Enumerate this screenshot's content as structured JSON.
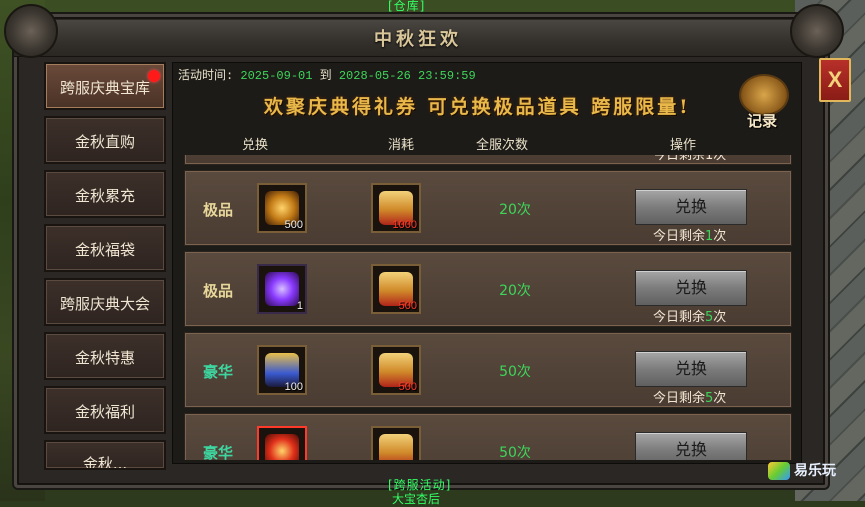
{
  "window": {
    "title": "中秋狂欢",
    "close_label": "X"
  },
  "scene": {
    "top_label": "[仓库]",
    "bottom_label_1": "[跨服活动]",
    "bottom_label_2": "大宝杏后"
  },
  "sidebar": {
    "items": [
      {
        "label": "跨服庆典宝库",
        "active": true,
        "notify": true
      },
      {
        "label": "金秋直购"
      },
      {
        "label": "金秋累充"
      },
      {
        "label": "金秋福袋"
      },
      {
        "label": "跨服庆典大会"
      },
      {
        "label": "金秋特惠"
      },
      {
        "label": "金秋福利"
      },
      {
        "label": "金秋..."
      }
    ]
  },
  "activity": {
    "time_label": "活动时间:",
    "start": "2025-09-01",
    "to": "到",
    "end": "2028-05-26 23:59:59",
    "banner": "欢聚庆典得礼券 可兑换极品道具 跨服限量!",
    "record_label": "记录"
  },
  "table": {
    "headers": {
      "exchange": "兑换",
      "cost": "消耗",
      "server_count": "全服次数",
      "action": "操作"
    },
    "partial_top_text": "今日剩余1次",
    "rows": [
      {
        "grade": "极品",
        "grade_color": "#e8d79a",
        "item_icon": "golden-ring-icon",
        "item_qty": "500",
        "cost_icon": "scroll-icon",
        "cost_qty": "1000",
        "count": "20次",
        "button": "兑换",
        "remain_prefix": "今日剩余",
        "remain_num": "1",
        "remain_suffix": "次"
      },
      {
        "grade": "极品",
        "grade_color": "#e8d79a",
        "item_icon": "purple-key-icon",
        "item_qty": "1",
        "cost_icon": "scroll-icon",
        "cost_qty": "500",
        "count": "20次",
        "button": "兑换",
        "remain_prefix": "今日剩余",
        "remain_num": "5",
        "remain_suffix": "次"
      },
      {
        "grade": "豪华",
        "grade_color": "#3dd6a0",
        "item_icon": "treasure-chest-icon",
        "item_qty": "100",
        "cost_icon": "scroll-icon",
        "cost_qty": "500",
        "count": "50次",
        "button": "兑换",
        "remain_prefix": "今日剩余",
        "remain_num": "5",
        "remain_suffix": "次"
      },
      {
        "grade": "豪华",
        "grade_color": "#3dd6a0",
        "item_icon": "red-crest-icon",
        "item_qty": "",
        "cost_icon": "scroll-icon",
        "cost_qty": "",
        "count": "50次",
        "button": "兑换",
        "remain_prefix": "",
        "remain_num": "",
        "remain_suffix": ""
      }
    ]
  },
  "watermark": {
    "text": "易乐玩"
  }
}
